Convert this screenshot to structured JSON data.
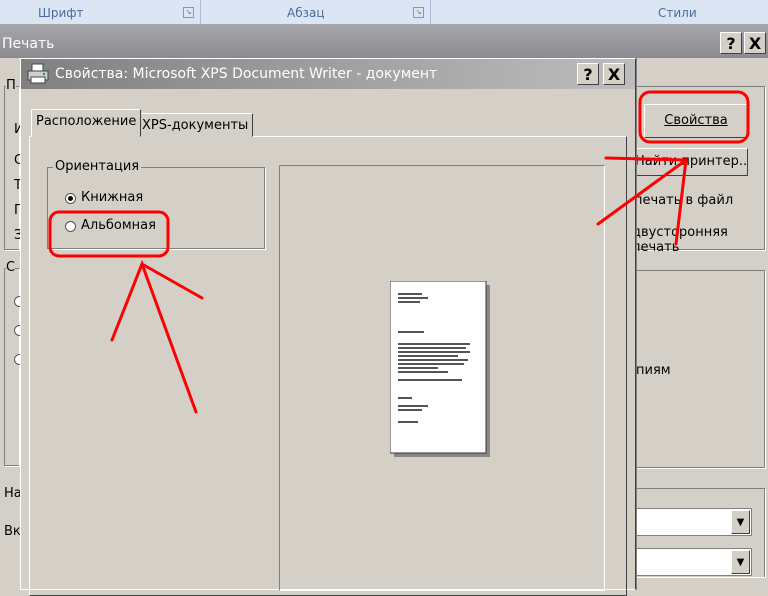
{
  "ribbon": {
    "font_group": "Шрифт",
    "paragraph_group": "Абзац",
    "styles_group": "Стили",
    "launcher_glyph": "↘"
  },
  "print_window": {
    "title": "Печать",
    "help_glyph": "?",
    "close_glyph": "X",
    "printer_group_fragment": "П",
    "row_fragments": [
      "И",
      "С",
      "Т",
      "Г",
      "З"
    ],
    "range_group_fragment": "С",
    "properties_button": "Свойства",
    "find_printer_button": "Найти принтер...",
    "print_to_file_label": "печать в файл",
    "duplex_label": "двусторонняя печать",
    "copies_fragment": "пиям",
    "print_what_fragment": "На",
    "include_fragment": "Вк",
    "combo_arrow": "▼"
  },
  "dialog": {
    "title": "Свойства: Microsoft XPS Document Writer - документ",
    "help_glyph": "?",
    "close_glyph": "X",
    "tabs": [
      {
        "label": "Расположение",
        "active": true
      },
      {
        "label": "XPS-документы",
        "active": false
      }
    ],
    "orientation": {
      "legend": "Ориентация",
      "options": [
        {
          "label": "Книжная",
          "selected": true
        },
        {
          "label": "Альбомная",
          "selected": false
        }
      ]
    }
  },
  "colors": {
    "annotation": "#ff0000",
    "dialog_face": "#d4d0c8",
    "ribbon": "#dbe5f3"
  }
}
